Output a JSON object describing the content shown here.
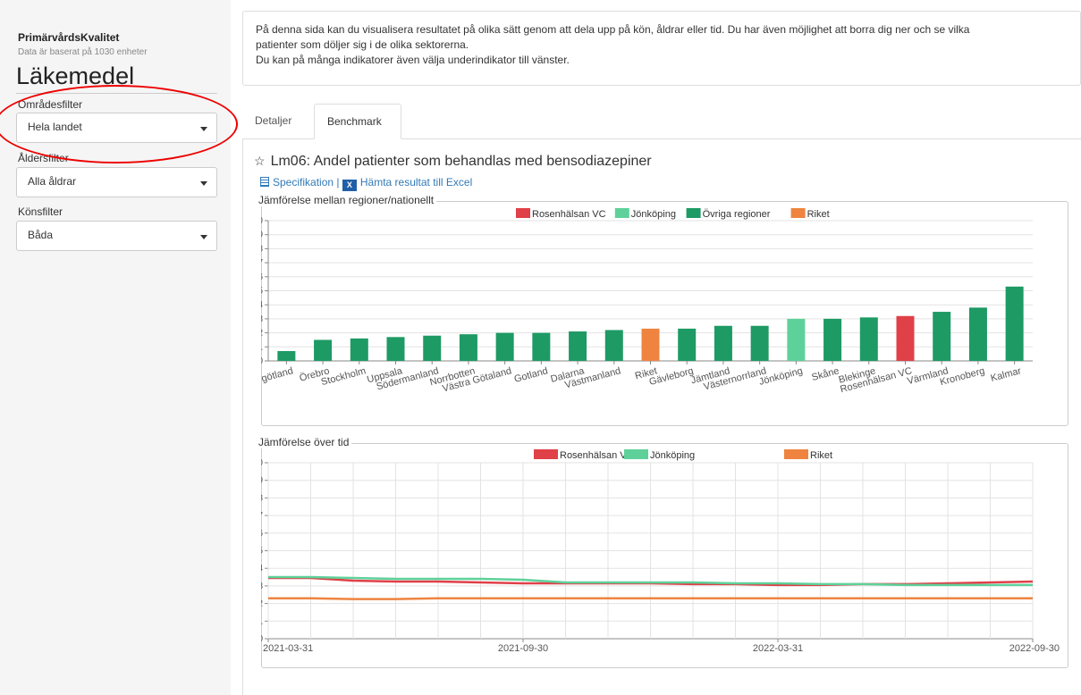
{
  "sidebar": {
    "app_title": "PrimärvårdsKvalitet",
    "data_note": "Data är baserat på 1030 enheter",
    "section_title": "Läkemedel",
    "filters": [
      {
        "label": "Områdesfilter",
        "value": "Hela landet"
      },
      {
        "label": "Åldersfilter",
        "value": "Alla åldrar"
      },
      {
        "label": "Könsfilter",
        "value": "Båda"
      }
    ]
  },
  "info": {
    "line1": "På denna sida kan du visualisera resultatet på olika sätt genom att dela upp på kön, åldrar eller tid. Du har även möjlighet att borra dig ner och se vilka",
    "line2": "patienter som döljer sig i de olika sektorerna.",
    "line3": "Du kan på många indikatorer även välja underindikator till vänster."
  },
  "tabs": [
    {
      "label": "Detaljer",
      "active": false
    },
    {
      "label": "Benchmark",
      "active": true
    }
  ],
  "indicator": {
    "title": "Lm06: Andel patienter som behandlas med bensodiazepiner",
    "spec_link": "Specifikation",
    "separator": "|",
    "excel_link": "Hämta resultat till Excel"
  },
  "colors": {
    "rosenhalsan": "#e04048",
    "jonkoping": "#5ed19a",
    "ovriga": "#1e9a64",
    "riket": "#ee8440"
  },
  "chart_data": [
    {
      "type": "bar",
      "title": "Jämförelse mellan regioner/nationellt",
      "legend": [
        "Rosenhälsan VC",
        "Jönköping",
        "Övriga regioner",
        "Riket"
      ],
      "legend_position": "top",
      "ylim": [
        0,
        10
      ],
      "yticks": [
        "0",
        "1",
        "2",
        "3",
        "4",
        "5",
        "6",
        "7",
        "8",
        "9",
        "10"
      ],
      "categories": [
        "Östergötland",
        "Örebro",
        "Stockholm",
        "Uppsala",
        "Södermanland",
        "Norrbotten",
        "Västra Götaland",
        "Gotland",
        "Dalarna",
        "Västmanland",
        "Riket",
        "Gävleborg",
        "Jämtland",
        "Västernorrland",
        "Jönköping",
        "Skåne",
        "Blekinge",
        "Rosenhälsan VC",
        "Värmland",
        "Kronoberg",
        "Kalmar"
      ],
      "values": [
        0.7,
        1.5,
        1.6,
        1.7,
        1.8,
        1.9,
        2.0,
        2.0,
        2.1,
        2.2,
        2.3,
        2.3,
        2.5,
        2.5,
        3.0,
        3.0,
        3.1,
        3.2,
        3.5,
        3.8,
        5.3
      ],
      "groups": [
        "ovriga",
        "ovriga",
        "ovriga",
        "ovriga",
        "ovriga",
        "ovriga",
        "ovriga",
        "ovriga",
        "ovriga",
        "ovriga",
        "riket",
        "ovriga",
        "ovriga",
        "ovriga",
        "jonkoping",
        "ovriga",
        "ovriga",
        "rosenhalsan",
        "ovriga",
        "ovriga",
        "ovriga"
      ],
      "grid": true
    },
    {
      "type": "line",
      "title": "Jämförelse över tid",
      "legend_position": "top",
      "ylim": [
        0,
        10
      ],
      "yticks": [
        "0",
        "1",
        "2",
        "3",
        "4",
        "5",
        "6",
        "7",
        "8",
        "9",
        "10"
      ],
      "x_labels": [
        "2021-03-31",
        "2021-09-30",
        "2022-03-31",
        "2022-09-30"
      ],
      "grid": true,
      "series": [
        {
          "name": "Rosenhälsan VC",
          "key": "rosenhalsan",
          "values": [
            3.45,
            3.45,
            3.3,
            3.25,
            3.25,
            3.2,
            3.15,
            3.15,
            3.15,
            3.15,
            3.1,
            3.1,
            3.05,
            3.05,
            3.1,
            3.1,
            3.15,
            3.2,
            3.25
          ]
        },
        {
          "name": "Jönköping",
          "key": "jonkoping",
          "values": [
            3.5,
            3.5,
            3.45,
            3.4,
            3.4,
            3.4,
            3.35,
            3.2,
            3.2,
            3.2,
            3.2,
            3.15,
            3.15,
            3.1,
            3.1,
            3.05,
            3.05,
            3.05,
            3.05
          ]
        },
        {
          "name": "Riket",
          "key": "riket",
          "values": [
            2.3,
            2.3,
            2.25,
            2.25,
            2.3,
            2.3,
            2.3,
            2.3,
            2.3,
            2.3,
            2.3,
            2.3,
            2.3,
            2.3,
            2.3,
            2.3,
            2.3,
            2.3,
            2.3
          ]
        }
      ]
    }
  ]
}
